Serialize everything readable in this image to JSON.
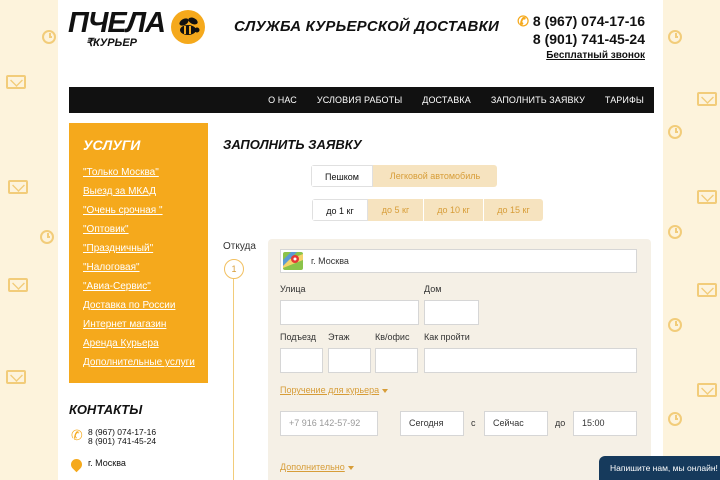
{
  "brand": {
    "name": "ПЧЕЛА",
    "sub": "КУРЬЕР",
    "accent": "#f5a91c"
  },
  "header": {
    "service_title": "СЛУЖБА КУРЬЕРСКОЙ ДОСТАВКИ",
    "phone_1": "8 (967) 074-17-16",
    "phone_2": "8 (901) 741-45-24",
    "free_call": "Бесплатный звонок"
  },
  "nav": {
    "items": [
      {
        "label": "О НАС"
      },
      {
        "label": "УСЛОВИЯ РАБОТЫ"
      },
      {
        "label": "ДОСТАВКА"
      },
      {
        "label": "ЗАПОЛНИТЬ ЗАЯВКУ"
      },
      {
        "label": "ТАРИФЫ"
      }
    ]
  },
  "sidebar": {
    "services_title": "УСЛУГИ",
    "services": [
      "\"Только Москва\"",
      "Выезд за МКАД",
      "\"Очень срочная \"",
      "\"Оптовик\"",
      "\"Праздничный\"",
      "\"Налоговая\"",
      "\"Авиа-Сервис\"",
      "Доставка по России",
      "Интернет магазин",
      "Аренда Курьера",
      "Дополнительные услуги"
    ],
    "contacts_title": "КОНТАКТЫ",
    "contact_phone_1": "8 (967) 074-17-16",
    "contact_phone_2": "8 (901) 741-45-24",
    "contact_city": "г. Москва"
  },
  "form": {
    "title": "ЗАПОЛНИТЬ ЗАЯВКУ",
    "transport": {
      "walk": "Пешком",
      "car": "Легковой автомобиль"
    },
    "weight": {
      "w1": "до 1 кг",
      "w5": "до 5 кг",
      "w10": "до 10 кг",
      "w15": "до 15 кг"
    },
    "from_label": "Откуда",
    "step": "1",
    "city_value": "г. Москва",
    "street_label": "Улица",
    "house_label": "Дом",
    "entrance_label": "Подъезд",
    "floor_label": "Этаж",
    "apt_label": "Кв/офис",
    "how_label": "Как пройти",
    "courier_task_link": "Поручение для курьера",
    "phone_placeholder": "+7 916 142-57-92",
    "date_value": "Сегодня",
    "from_word": "с",
    "time_from": "Сейчас",
    "to_word": "до",
    "time_to": "15:00",
    "additional_link": "Дополнительно"
  },
  "chat": {
    "text": "Напишите нам, мы онлайн!"
  }
}
